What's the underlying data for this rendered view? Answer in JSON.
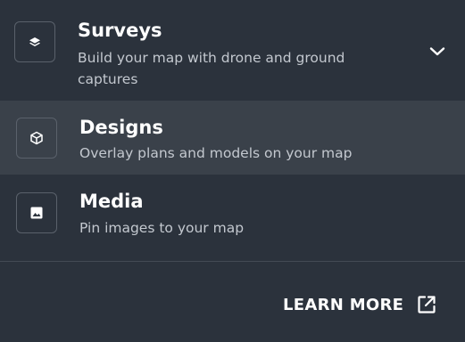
{
  "menu": {
    "items": [
      {
        "title": "Surveys",
        "description": "Build your map with drone and ground captures",
        "icon": "layers-icon",
        "expanded_indicator": "chevron-down-icon"
      },
      {
        "title": "Designs",
        "description": "Overlay plans and models on your map",
        "icon": "cube-icon",
        "highlighted": true
      },
      {
        "title": "Media",
        "description": "Pin images to your map",
        "icon": "image-icon"
      }
    ]
  },
  "footer": {
    "learn_more_label": "LEARN MORE",
    "learn_more_icon": "external-link-icon"
  },
  "colors": {
    "background": "#2b323c",
    "highlight": "#3a414a",
    "text_primary": "#ffffff",
    "text_secondary": "#c3c8cf",
    "border": "#5a616b"
  }
}
